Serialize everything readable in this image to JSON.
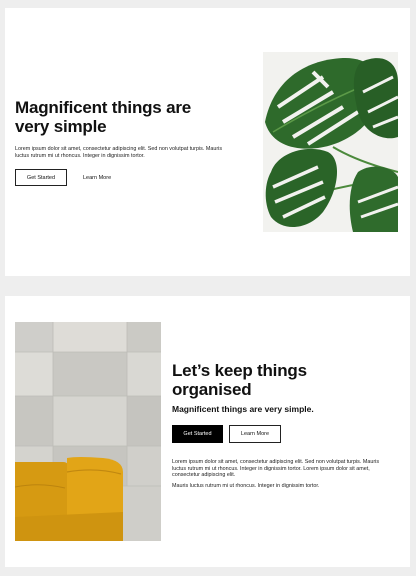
{
  "hero": {
    "title": "Magnificent things are very simple",
    "body": "Lorem ipsum dolor sit amet, consectetur adipiscing elit. Sed non volutpat turpis. Mauris luctus rutrum mi ut rhoncus. Integer in dignissim tortor.",
    "primary_button": "Get Started",
    "secondary_button": "Learn More",
    "image": "monstera-leaf-image"
  },
  "feature": {
    "title": "Let’s keep things organised",
    "subtitle": "Magnificent things are very simple.",
    "primary_button": "Get Started",
    "secondary_button": "Learn More",
    "paragraph_1": "Lorem ipsum dolor sit amet, consectetur adipiscing elit. Sed non volutpat turpis. Mauris luctus rutrum mi ut rhoncus. Integer in dignissim tortor. Lorem ipsum dolor sit amet, consectetur adipiscing elit.",
    "paragraph_2": "Mauris luctus rutrum mi ut rhoncus. Integer in dignissim tortor.",
    "image": "yellow-chair-marble-wall-image"
  },
  "colors": {
    "page_background": "#eeeeee",
    "card_background": "#ffffff",
    "primary_button": "#000000",
    "leaf_green": "#2f6b2c",
    "chair_yellow": "#e0a317"
  }
}
